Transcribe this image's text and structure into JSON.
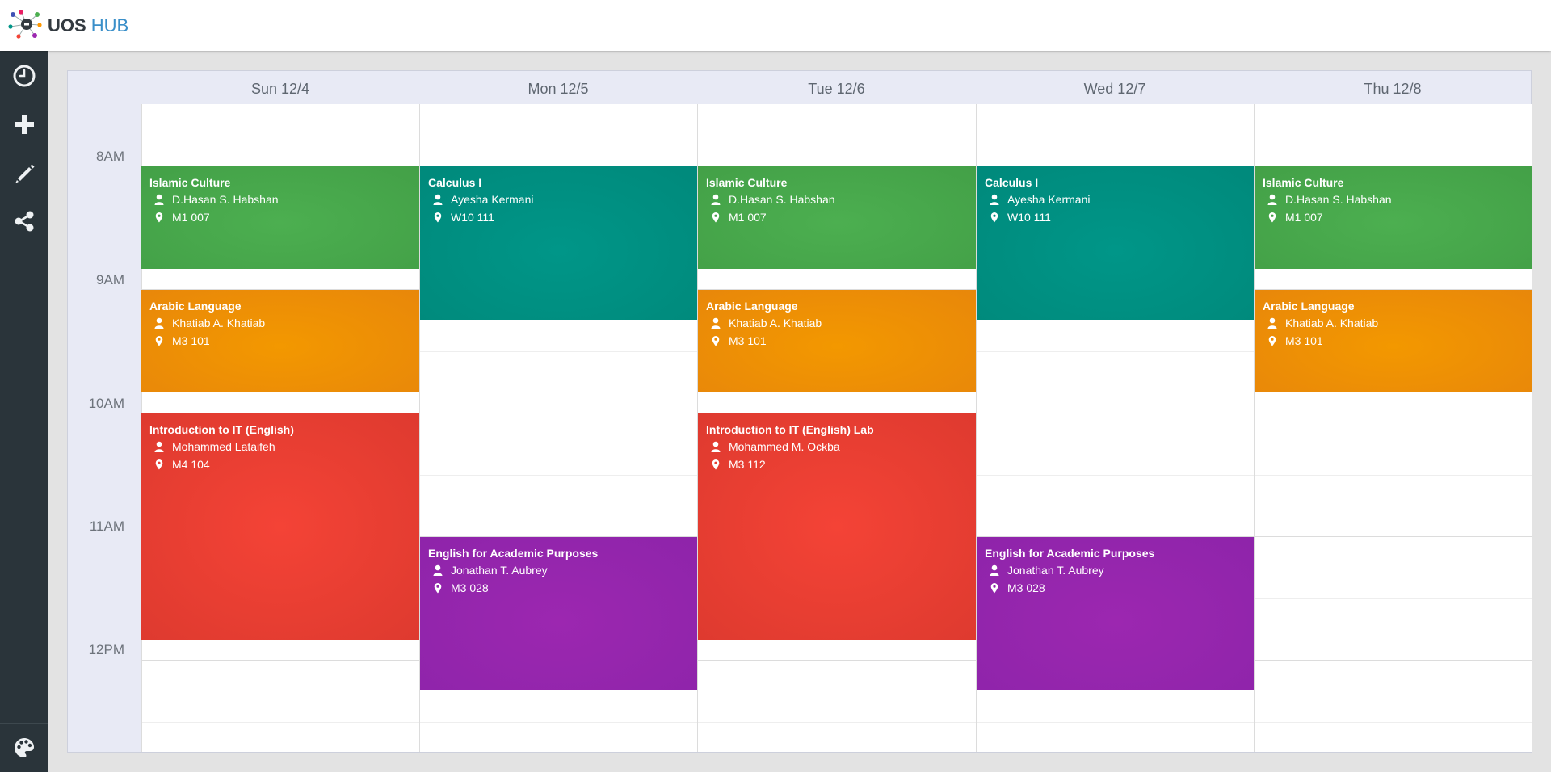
{
  "app": {
    "brand_primary": "UOS",
    "brand_secondary": "HUB"
  },
  "sidebar": {
    "items": [
      {
        "icon": "clock-icon"
      },
      {
        "icon": "plus-icon"
      },
      {
        "icon": "pencil-icon"
      },
      {
        "icon": "share-icon"
      }
    ],
    "footer_icon": "palette-icon"
  },
  "calendar": {
    "days": [
      "Sun 12/4",
      "Mon 12/5",
      "Tue 12/6",
      "Wed 12/7",
      "Thu 12/8"
    ],
    "time_labels": [
      "8AM",
      "9AM",
      "10AM",
      "11AM",
      "12PM"
    ],
    "events": {
      "sun_islamic": {
        "title": "Islamic Culture",
        "instructor": "D.Hasan S. Habshan",
        "room": "M1 007"
      },
      "sun_arabic": {
        "title": "Arabic Language",
        "instructor": "Khatiab A. Khatiab",
        "room": "M3 101"
      },
      "sun_intro": {
        "title": "Introduction to IT (English)",
        "instructor": "Mohammed Lataifeh",
        "room": "M4 104"
      },
      "mon_calc": {
        "title": "Calculus I",
        "instructor": "Ayesha Kermani",
        "room": "W10 111"
      },
      "mon_english": {
        "title": "English for Academic Purposes",
        "instructor": "Jonathan T. Aubrey",
        "room": "M3 028"
      },
      "tue_islamic": {
        "title": "Islamic Culture",
        "instructor": "D.Hasan S. Habshan",
        "room": "M1 007"
      },
      "tue_arabic": {
        "title": "Arabic Language",
        "instructor": "Khatiab A. Khatiab",
        "room": "M3 101"
      },
      "tue_lab": {
        "title": "Introduction to IT (English) Lab",
        "instructor": "Mohammed M. Ockba",
        "room": "M3 112"
      },
      "wed_calc": {
        "title": "Calculus I",
        "instructor": "Ayesha Kermani",
        "room": "W10 111"
      },
      "wed_english": {
        "title": "English for Academic Purposes",
        "instructor": "Jonathan T. Aubrey",
        "room": "M3 028"
      },
      "thu_islamic": {
        "title": "Islamic Culture",
        "instructor": "D.Hasan S. Habshan",
        "room": "M1 007"
      },
      "thu_arabic": {
        "title": "Arabic Language",
        "instructor": "Khatiab A. Khatiab",
        "room": "M3 101"
      }
    }
  },
  "colors": {
    "islamic_culture": "#43a047",
    "calculus": "#00897b",
    "arabic": "#ef8c00",
    "intro_it": "#f44336",
    "english": "#8e24aa",
    "sidebar": "#2a343a",
    "brand_accent": "#3a8fc9"
  }
}
